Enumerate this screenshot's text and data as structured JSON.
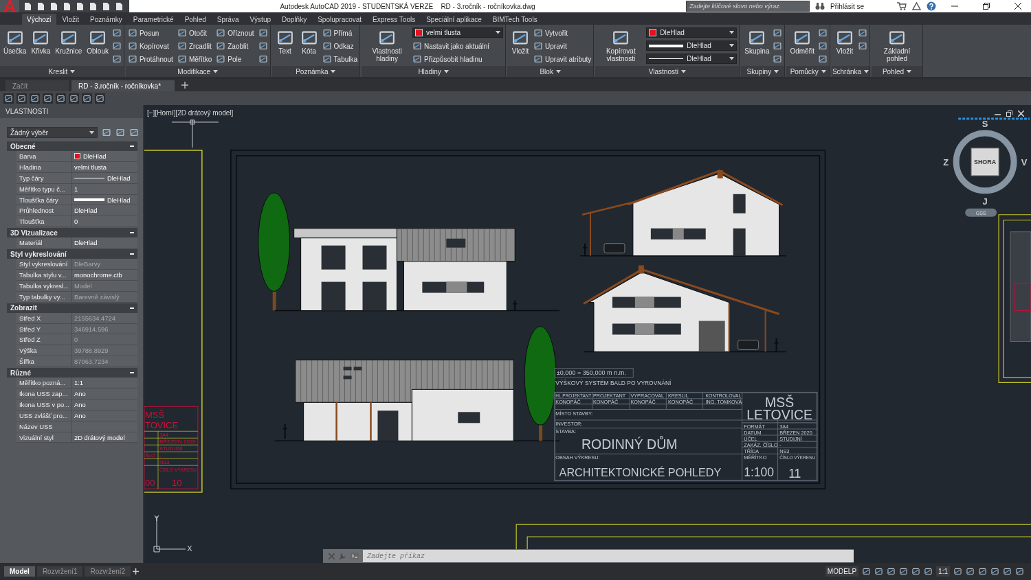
{
  "title_bar": {
    "title": "Autodesk AutoCAD 2019 - STUDENTSKÁ VERZE    RD - 3.ročník - ročníkovka.dwg",
    "search": {
      "placeholder": "Zadejte klíčové slovo nebo výraz."
    },
    "sign_in": "Přihlásit se"
  },
  "ribbon_tabs": [
    {
      "label": "Výchozí",
      "selected": true
    },
    {
      "label": "Vložit",
      "selected": false
    },
    {
      "label": "Poznámky",
      "selected": false
    },
    {
      "label": "Parametrické",
      "selected": false
    },
    {
      "label": "Pohled",
      "selected": false
    },
    {
      "label": "Správa",
      "selected": false
    },
    {
      "label": "Výstup",
      "selected": false
    },
    {
      "label": "Doplňky",
      "selected": false
    },
    {
      "label": "Spolupracovat",
      "selected": false
    },
    {
      "label": "Express Tools",
      "selected": false
    },
    {
      "label": "Speciální aplikace",
      "selected": false
    },
    {
      "label": "BIMTech Tools",
      "selected": false
    }
  ],
  "ribbon_panels": [
    {
      "title": "Kreslit",
      "tools": [
        {
          "kind": "large",
          "label": "Úsečka"
        },
        {
          "kind": "large",
          "label": "Křivka"
        },
        {
          "kind": "large",
          "label": "Kružnice"
        },
        {
          "kind": "large",
          "label": "Oblouk"
        },
        {
          "kind": "icon"
        },
        {
          "kind": "icon"
        },
        {
          "kind": "icon"
        }
      ]
    },
    {
      "title": "Modifikace",
      "tools": [
        {
          "kind": "small",
          "label": "Posun"
        },
        {
          "kind": "small",
          "label": "Kopírovat"
        },
        {
          "kind": "small",
          "label": "Protáhnout"
        },
        {
          "kind": "small",
          "label": "Otočit"
        },
        {
          "kind": "small",
          "label": "Zrcadlit"
        },
        {
          "kind": "small",
          "label": "Měřítko"
        },
        {
          "kind": "small",
          "label": "Oříznout"
        },
        {
          "kind": "small",
          "label": "Zaoblit"
        },
        {
          "kind": "small",
          "label": "Pole"
        },
        {
          "kind": "icon"
        },
        {
          "kind": "icon"
        },
        {
          "kind": "icon"
        }
      ]
    },
    {
      "title": "Poznámka",
      "tools": [
        {
          "kind": "large",
          "label": "Text"
        },
        {
          "kind": "large",
          "label": "Kóta"
        },
        {
          "kind": "small",
          "label": "Přímá"
        },
        {
          "kind": "small",
          "label": "Odkaz"
        },
        {
          "kind": "small",
          "label": "Tabulka"
        }
      ]
    },
    {
      "title": "Hladiny",
      "tools": [
        {
          "kind": "large",
          "label": "Vlastnosti hladiny"
        },
        {
          "kind": "color-dropdown",
          "label": "velmi tlusta",
          "color": "#e8101e"
        },
        {
          "kind": "small",
          "label": "Nastavit jako aktuální"
        },
        {
          "kind": "small",
          "label": "Přizpůsobit hladinu"
        }
      ]
    },
    {
      "title": "Blok",
      "tools": [
        {
          "kind": "large",
          "label": "Vložit"
        },
        {
          "kind": "small",
          "label": "Vytvořit"
        },
        {
          "kind": "small",
          "label": "Upravit"
        },
        {
          "kind": "small",
          "label": "Upravit atributy"
        }
      ]
    },
    {
      "title": "Vlastnosti",
      "tools": [
        {
          "kind": "large",
          "label": "Kopírovat vlastnosti"
        },
        {
          "kind": "color-dropdown",
          "label": "DleHlad",
          "color": "#e8101e"
        },
        {
          "kind": "lineweight-dropdown",
          "label": "DleHlad"
        },
        {
          "kind": "linetype-dropdown",
          "label": "DleHlad"
        }
      ]
    },
    {
      "title": "Skupiny",
      "tools": [
        {
          "kind": "large",
          "label": "Skupina"
        },
        {
          "kind": "icon"
        },
        {
          "kind": "icon"
        },
        {
          "kind": "icon"
        }
      ]
    },
    {
      "title": "Pomůcky",
      "tools": [
        {
          "kind": "large",
          "label": "Odměřit"
        },
        {
          "kind": "icon"
        },
        {
          "kind": "icon"
        },
        {
          "kind": "icon"
        }
      ]
    },
    {
      "title": "Schránka",
      "tools": [
        {
          "kind": "large",
          "label": "Vložit"
        },
        {
          "kind": "icon"
        },
        {
          "kind": "icon"
        }
      ]
    },
    {
      "title": "Pohled",
      "tools": [
        {
          "kind": "large",
          "label": "Základní pohled"
        }
      ]
    }
  ],
  "file_tabs": [
    {
      "label": "Začít",
      "selected": false
    },
    {
      "label": "RD - 3.ročník - ročníkovka*",
      "selected": true
    }
  ],
  "properties": {
    "title": "VLASTNOSTI",
    "selection": "Žádný výběr",
    "sections": [
      {
        "title": "Obecné",
        "expanded": true,
        "rows": [
          {
            "label": "Barva",
            "value": "DleHlad",
            "kind": "color",
            "color": "#e8101e",
            "disabled": false
          },
          {
            "label": "Hladina",
            "value": "velmi tlusta",
            "kind": "text",
            "disabled": false
          },
          {
            "label": "Typ čáry",
            "value": "DleHlad",
            "kind": "linetype",
            "disabled": false
          },
          {
            "label": "Měřítko typu č...",
            "value": "1",
            "kind": "text",
            "disabled": false
          },
          {
            "label": "Tloušťka čáry",
            "value": "DleHlad",
            "kind": "lineweight",
            "disabled": false
          },
          {
            "label": "Průhlednost",
            "value": "DleHlad",
            "kind": "text",
            "disabled": false
          },
          {
            "label": "Tloušťka",
            "value": "0",
            "kind": "text",
            "disabled": false
          }
        ]
      },
      {
        "title": "3D Vizualizace",
        "expanded": true,
        "rows": [
          {
            "label": "Materiál",
            "value": "DleHlad",
            "kind": "text",
            "disabled": false
          }
        ]
      },
      {
        "title": "Styl vykreslování",
        "expanded": true,
        "rows": [
          {
            "label": "Styl vykreslování",
            "value": "DleBarvy",
            "kind": "text",
            "disabled": true
          },
          {
            "label": "Tabulka stylu v...",
            "value": "monochrome.ctb",
            "kind": "text",
            "disabled": false
          },
          {
            "label": "Tabulka vykresl...",
            "value": "Model",
            "kind": "text",
            "disabled": true
          },
          {
            "label": "Typ tabulky vy...",
            "value": "Barevně závislý",
            "kind": "text",
            "disabled": true
          }
        ]
      },
      {
        "title": "Zobrazit",
        "expanded": true,
        "rows": [
          {
            "label": "Střed X",
            "value": "2155634.4724",
            "kind": "text",
            "disabled": true
          },
          {
            "label": "Střed Y",
            "value": "346914.596",
            "kind": "text",
            "disabled": true
          },
          {
            "label": "Střed Z",
            "value": "0",
            "kind": "text",
            "disabled": true
          },
          {
            "label": "Výška",
            "value": "39788.8929",
            "kind": "text",
            "disabled": true
          },
          {
            "label": "Šířka",
            "value": "87063.7234",
            "kind": "text",
            "disabled": true
          }
        ]
      },
      {
        "title": "Různé",
        "expanded": true,
        "rows": [
          {
            "label": "Měřítko pozná...",
            "value": "1:1",
            "kind": "text",
            "disabled": false
          },
          {
            "label": "Ikona USS zap...",
            "value": "Ano",
            "kind": "text",
            "disabled": false
          },
          {
            "label": "Ikona USS v po...",
            "value": "Ano",
            "kind": "text",
            "disabled": false
          },
          {
            "label": "USS zvlášť pro...",
            "value": "Ano",
            "kind": "text",
            "disabled": false
          },
          {
            "label": "Název USS",
            "kind": "text",
            "disabled": false
          },
          {
            "label": "Vizuální styl",
            "value": "2D drátový model",
            "kind": "text",
            "disabled": false
          }
        ]
      }
    ]
  },
  "viewport": {
    "label": "[−][Horní][2D drátový model]",
    "viewcube": {
      "north": "S",
      "south": "J",
      "west": "Z",
      "east": "V",
      "face": "SHORA",
      "coordinate_system": "GSS"
    },
    "ucs": {
      "y": "Y",
      "x": "X"
    }
  },
  "left_title_block": {
    "texts": [
      "MSŠ",
      "TOVICE",
      "3A4",
      "BŘEZEN 2020",
      "STUDIJNÍ",
      "ŠLO",
      "-",
      "NS3",
      "ČÍSLO VÝKRESU",
      "00",
      "10"
    ]
  },
  "title_block": {
    "elevation_note": "±0,000 = 350,000 m n.m.",
    "height_system": "VÝŠKOVÝ SYSTÉM BALD PO VYROVNÁNÍ",
    "roles": [
      {
        "role": "HL.PROJEKTANT",
        "name": "KONOPÁČ"
      },
      {
        "role": "PROJEKTANT",
        "name": "KONOPÁČ"
      },
      {
        "role": "VYPRACOVAL",
        "name": "KONOPÁČ"
      },
      {
        "role": "KRESLIL",
        "name": "KONOPÁČ"
      },
      {
        "role": "KONTROLOVAL",
        "name": "ING. TOMKOVÁ"
      }
    ],
    "site_label": "MÍSTO STAVBY:",
    "investor_label": "INVESTOR:",
    "building_label": "STAVBA:",
    "building": "RODINNÝ DŮM",
    "content_label": "OBSAH VÝKRESU:",
    "content": "ARCHITEKTONICKÉ POHLEDY",
    "school": [
      "MSŠ",
      "LETOVICE"
    ],
    "fields": [
      {
        "label": "FORMÁT",
        "value": "3A4"
      },
      {
        "label": "DATUM",
        "value": "BŘEZEN 2020"
      },
      {
        "label": "ÚČEL",
        "value": "STUDIJNÍ"
      },
      {
        "label": "ZAKÁZ. ČÍSLO",
        "value": "-"
      },
      {
        "label": "TŘÍDA",
        "value": "NS3"
      }
    ],
    "scale_label": "MĚŘÍTKO",
    "scale": "1:100",
    "sheet_label": "ČÍSLO VÝKRESU",
    "sheet": "11"
  },
  "command_line": {
    "placeholder": "Zadejte příkaz"
  },
  "layout_tabs": [
    {
      "label": "Model",
      "selected": true
    },
    {
      "label": "Rozvržení1",
      "selected": false
    },
    {
      "label": "Rozvržení2",
      "selected": false
    }
  ],
  "status_bar": {
    "space": "MODELP",
    "annotation_scale": "1:1"
  }
}
